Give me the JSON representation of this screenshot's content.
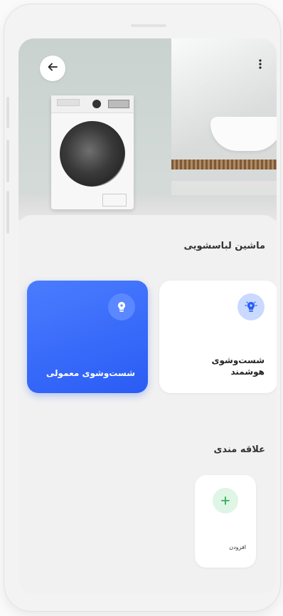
{
  "header": {
    "back_icon": "arrow-left-icon",
    "more_icon": "more-vertical-icon"
  },
  "device": {
    "title": "ماشین لباسشویی"
  },
  "modes": [
    {
      "label": "شست‌وشوی هوشمند",
      "icon": "bulb-gear-icon",
      "selected": false
    },
    {
      "label": "شست‌وشوی معمولی",
      "icon": "bulb-gear-icon",
      "selected": true
    }
  ],
  "favorites": {
    "title": "علاقه مندی",
    "add_label": "افزودن",
    "add_icon": "plus-icon"
  },
  "colors": {
    "accent": "#2a5cf5",
    "add_bg": "#dff5e6",
    "add_plus": "#2fae58"
  }
}
